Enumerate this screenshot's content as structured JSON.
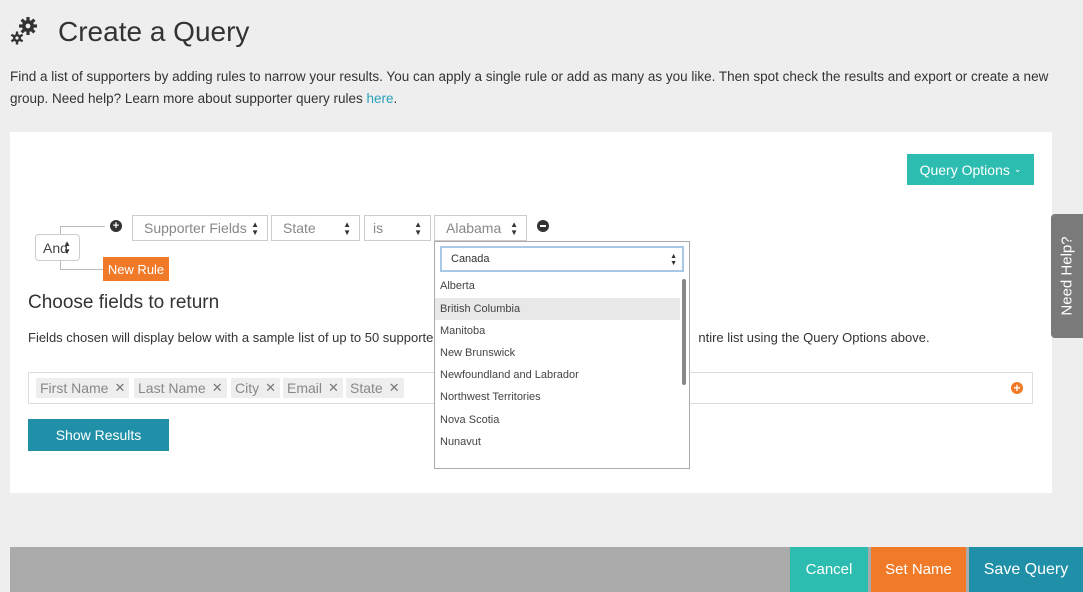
{
  "header": {
    "title": "Create a Query",
    "icon": "gears-icon"
  },
  "intro": {
    "text": "Find a list of supporters by adding rules to narrow your results. You can apply a single rule or add as many as you like. Then spot check the results and export or create a new group. Need help? Learn more about supporter query rules ",
    "link": "here",
    "end": "."
  },
  "query_options": {
    "label": "Query Options"
  },
  "rule": {
    "logic": "And",
    "field_group": "Supporter Fields",
    "field": "State",
    "operator": "is",
    "value": "Alabama"
  },
  "new_rule": {
    "label": "New Rule"
  },
  "fields_section": {
    "title": "Choose fields to return",
    "desc_part1": "Fields chosen will display below with a sample list of up to 50 supporte",
    "desc_part2": "ntire list using the Query Options above.",
    "tags": [
      "First Name",
      "Last Name",
      "City",
      "Email",
      "State"
    ]
  },
  "show_results": {
    "label": "Show Results"
  },
  "dropdown": {
    "country": "Canada",
    "options": [
      "Alberta",
      "British Columbia",
      "Manitoba",
      "New Brunswick",
      "Newfoundland and Labrador",
      "Northwest Territories",
      "Nova Scotia",
      "Nunavut"
    ],
    "highlighted": "British Columbia"
  },
  "need_help": {
    "label": "Need Help?"
  },
  "footer": {
    "cancel": "Cancel",
    "set_name": "Set Name",
    "save_query": "Save Query"
  },
  "colors": {
    "teal": "#2cbcb0",
    "orange": "#f07a27",
    "blue": "#2090a8"
  }
}
